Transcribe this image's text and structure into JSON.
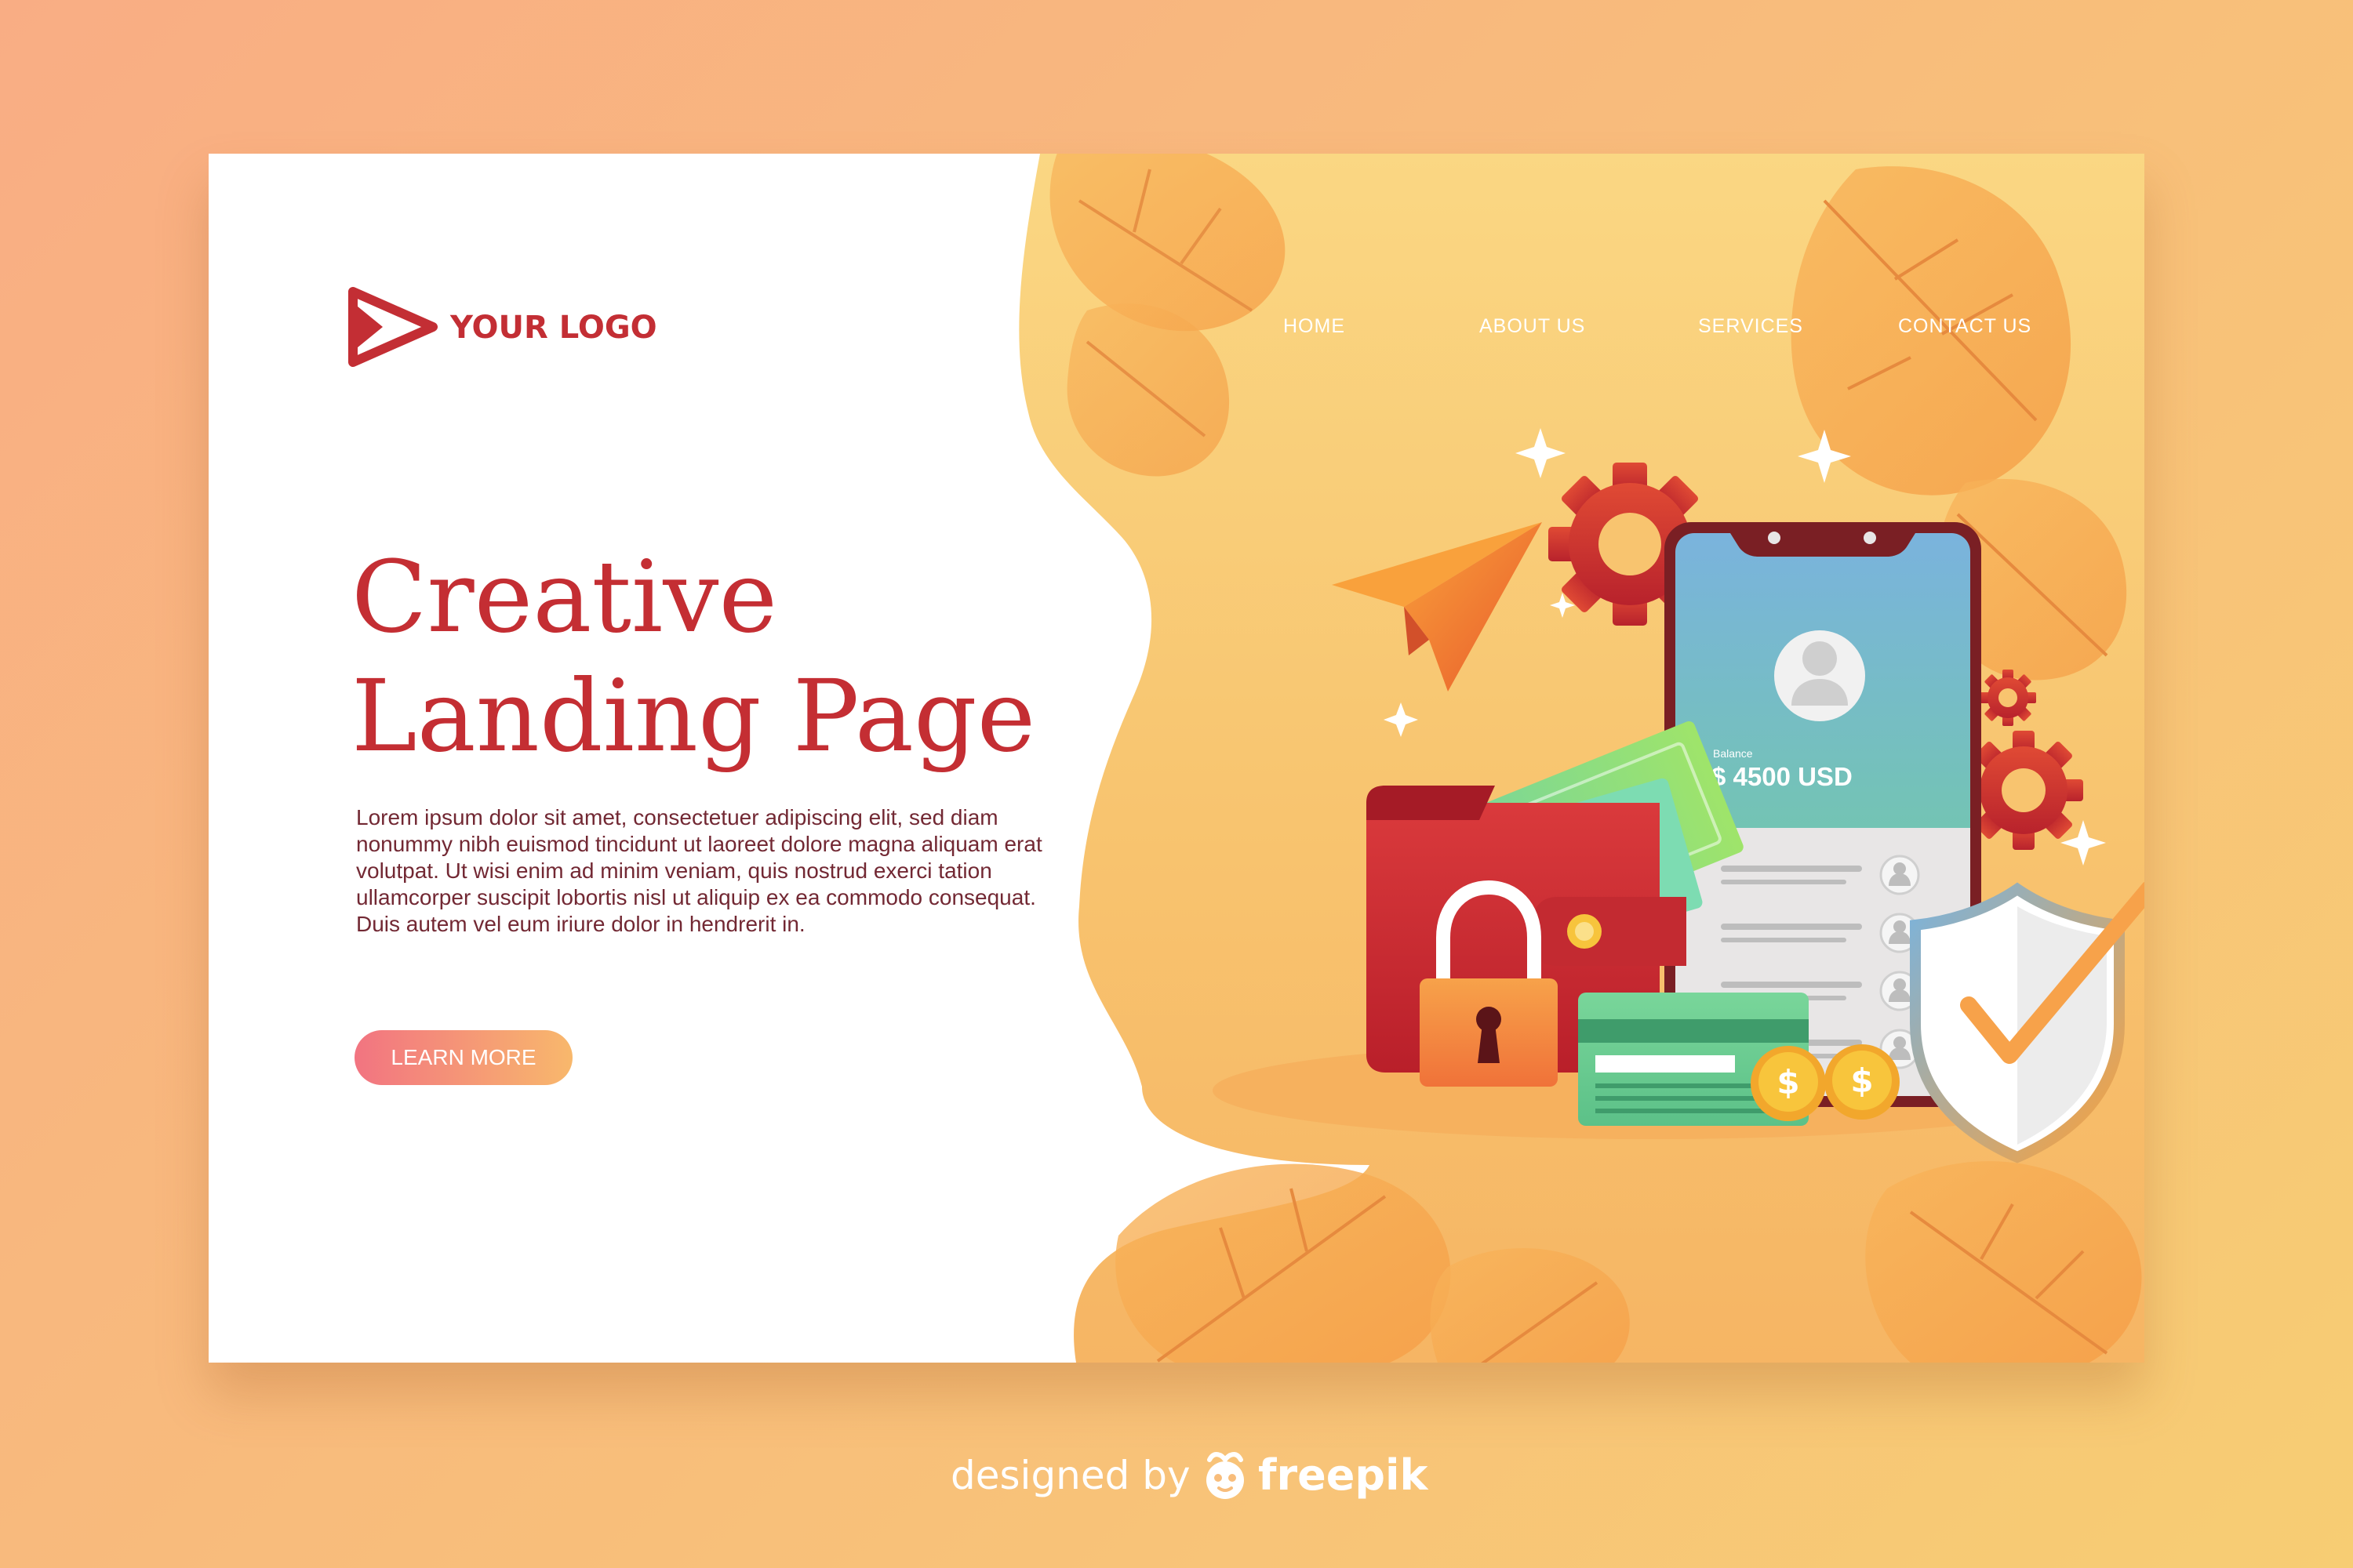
{
  "logo": {
    "text": "YOUR LOGO"
  },
  "nav": {
    "items": [
      "HOME",
      "ABOUT US",
      "SERVICES",
      "CONTACT US"
    ]
  },
  "hero": {
    "headline_line1": "Creative",
    "headline_line2": "Landing Page",
    "body": "Lorem ipsum dolor sit amet, consectetuer adipiscing elit, sed diam nonummy nibh euismod tincidunt ut laoreet dolore magna aliquam erat volutpat. Ut wisi enim ad minim veniam, quis nostrud exerci tation ullamcorper suscipit lobortis nisl ut aliquip ex ea commodo consequat. Duis autem vel eum iriure dolor in hendrerit in.",
    "cta_label": "LEARN MORE"
  },
  "phone": {
    "balance_label": "Balance",
    "balance_value": "$ 4500 USD"
  },
  "coin_symbol": "$",
  "credit": {
    "prefix": "designed by",
    "brand": "freepik"
  },
  "colors": {
    "brand_red": "#c42e33",
    "background_orange": "#f8bd7b",
    "cta_gradient_start": "#f27481",
    "cta_gradient_end": "#f8b86c",
    "body_text": "#722833"
  },
  "icons": [
    "play-logo-icon",
    "paper-plane-icon",
    "gear-icon",
    "banknote-icon",
    "wallet-icon",
    "padlock-icon",
    "smartphone-icon",
    "user-avatar-icon",
    "credit-card-icon",
    "coin-icon",
    "shield-check-icon",
    "sparkle-icon",
    "leaf-icon",
    "freepik-logo-icon"
  ]
}
